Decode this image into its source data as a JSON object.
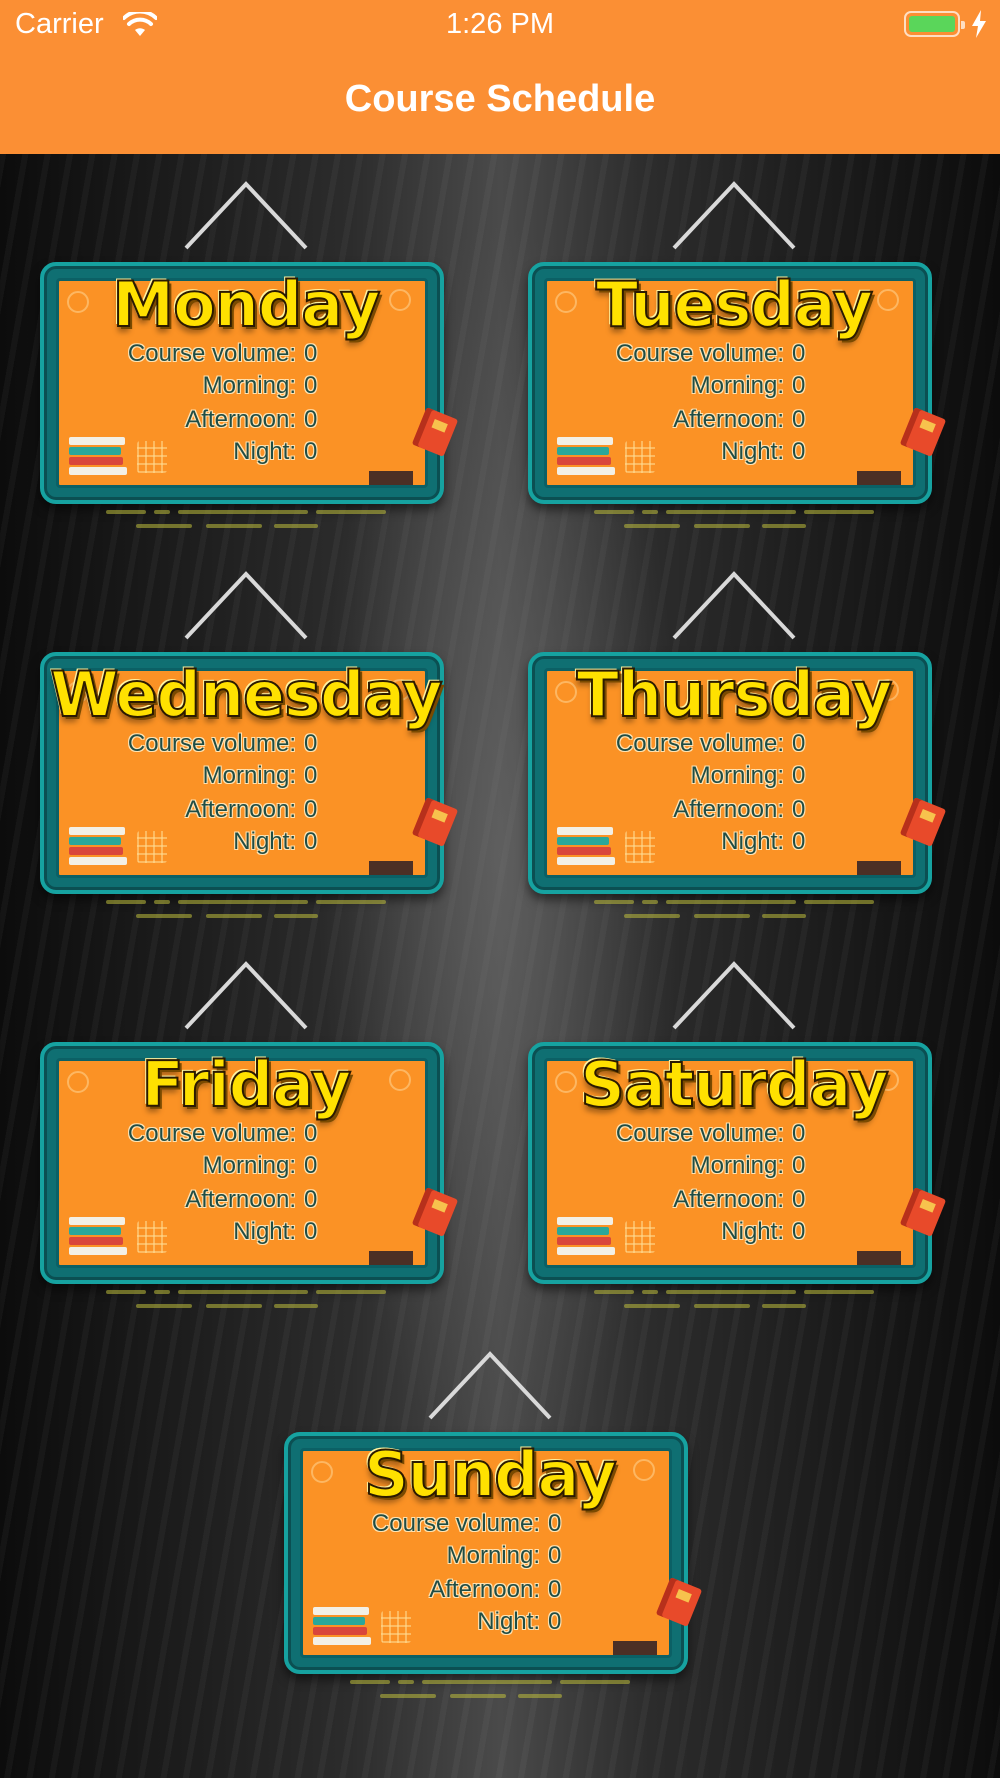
{
  "status_bar": {
    "carrier": "Carrier",
    "time": "1:26 PM"
  },
  "nav": {
    "title": "Course Schedule"
  },
  "labels": {
    "course_volume": "Course volume:",
    "morning": "Morning:",
    "afternoon": "Afternoon:",
    "night": "Night:"
  },
  "days": [
    {
      "name": "Monday",
      "course_volume": "0",
      "morning": "0",
      "afternoon": "0",
      "night": "0"
    },
    {
      "name": "Tuesday",
      "course_volume": "0",
      "morning": "0",
      "afternoon": "0",
      "night": "0"
    },
    {
      "name": "Wednesday",
      "course_volume": "0",
      "morning": "0",
      "afternoon": "0",
      "night": "0"
    },
    {
      "name": "Thursday",
      "course_volume": "0",
      "morning": "0",
      "afternoon": "0",
      "night": "0"
    },
    {
      "name": "Friday",
      "course_volume": "0",
      "morning": "0",
      "afternoon": "0",
      "night": "0"
    },
    {
      "name": "Saturday",
      "course_volume": "0",
      "morning": "0",
      "afternoon": "0",
      "night": "0"
    },
    {
      "name": "Sunday",
      "course_volume": "0",
      "morning": "0",
      "afternoon": "0",
      "night": "0"
    }
  ],
  "colors": {
    "nav_bar": "#fb8f34",
    "board_panel": "#fb9225",
    "board_frame": "#16a2a0",
    "day_title": "#ffe100",
    "battery": "#5ad65a"
  }
}
